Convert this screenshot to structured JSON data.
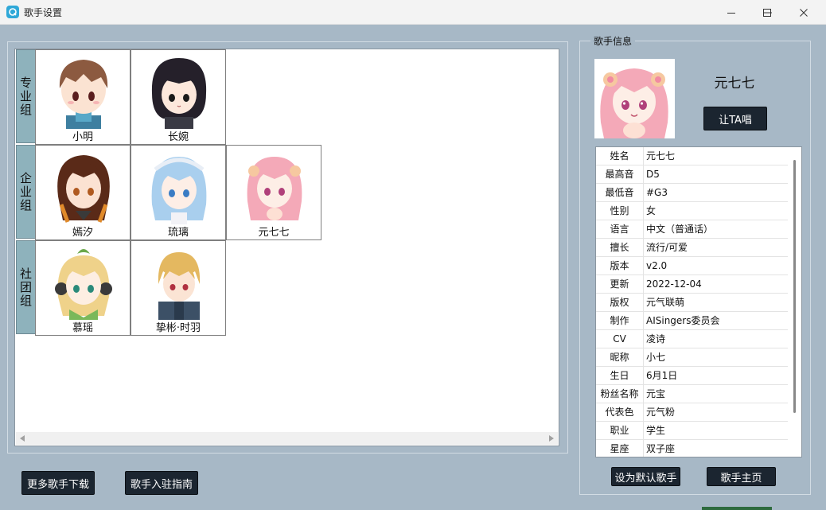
{
  "window": {
    "title": "歌手设置"
  },
  "groups": [
    {
      "label": "专业组",
      "singers": [
        "小明",
        "长婉"
      ]
    },
    {
      "label": "企业组",
      "singers": [
        "嫣汐",
        "琉璃",
        "元七七"
      ]
    },
    {
      "label": "社团组",
      "singers": [
        "慕瑶",
        "挚彬·时羽"
      ]
    }
  ],
  "buttons": {
    "more_download": "更多歌手下载",
    "join_guide": "歌手入驻指南",
    "let_sing": "让TA唱",
    "set_default": "设为默认歌手",
    "homepage": "歌手主页"
  },
  "info_panel": {
    "legend": "歌手信息",
    "singer_name": "元七七",
    "rows": [
      {
        "k": "姓名",
        "v": "元七七"
      },
      {
        "k": "最高音",
        "v": " D5"
      },
      {
        "k": "最低音",
        "v": "#G3"
      },
      {
        "k": "性别",
        "v": "女"
      },
      {
        "k": "语言",
        "v": "中文（普通话）"
      },
      {
        "k": "擅长",
        "v": "流行/可爱"
      },
      {
        "k": "版本",
        "v": "v2.0"
      },
      {
        "k": "更新",
        "v": "2022-12-04"
      },
      {
        "k": "版权",
        "v": "元气联萌"
      },
      {
        "k": "制作",
        "v": "AISingers委员会"
      },
      {
        "k": "CV",
        "v": "凌诗"
      },
      {
        "k": "昵称",
        "v": "小七"
      },
      {
        "k": "生日",
        "v": "6月1日"
      },
      {
        "k": "粉丝名称",
        "v": "元宝"
      },
      {
        "k": "代表色",
        "v": "元气粉"
      },
      {
        "k": "职业",
        "v": "学生"
      },
      {
        "k": "星座",
        "v": "双子座"
      }
    ]
  },
  "colors": {
    "background": "#a7b8c6",
    "row_header": "#8eb2bc",
    "button": "#1b2530",
    "app_icon": "#2fa8d8"
  }
}
